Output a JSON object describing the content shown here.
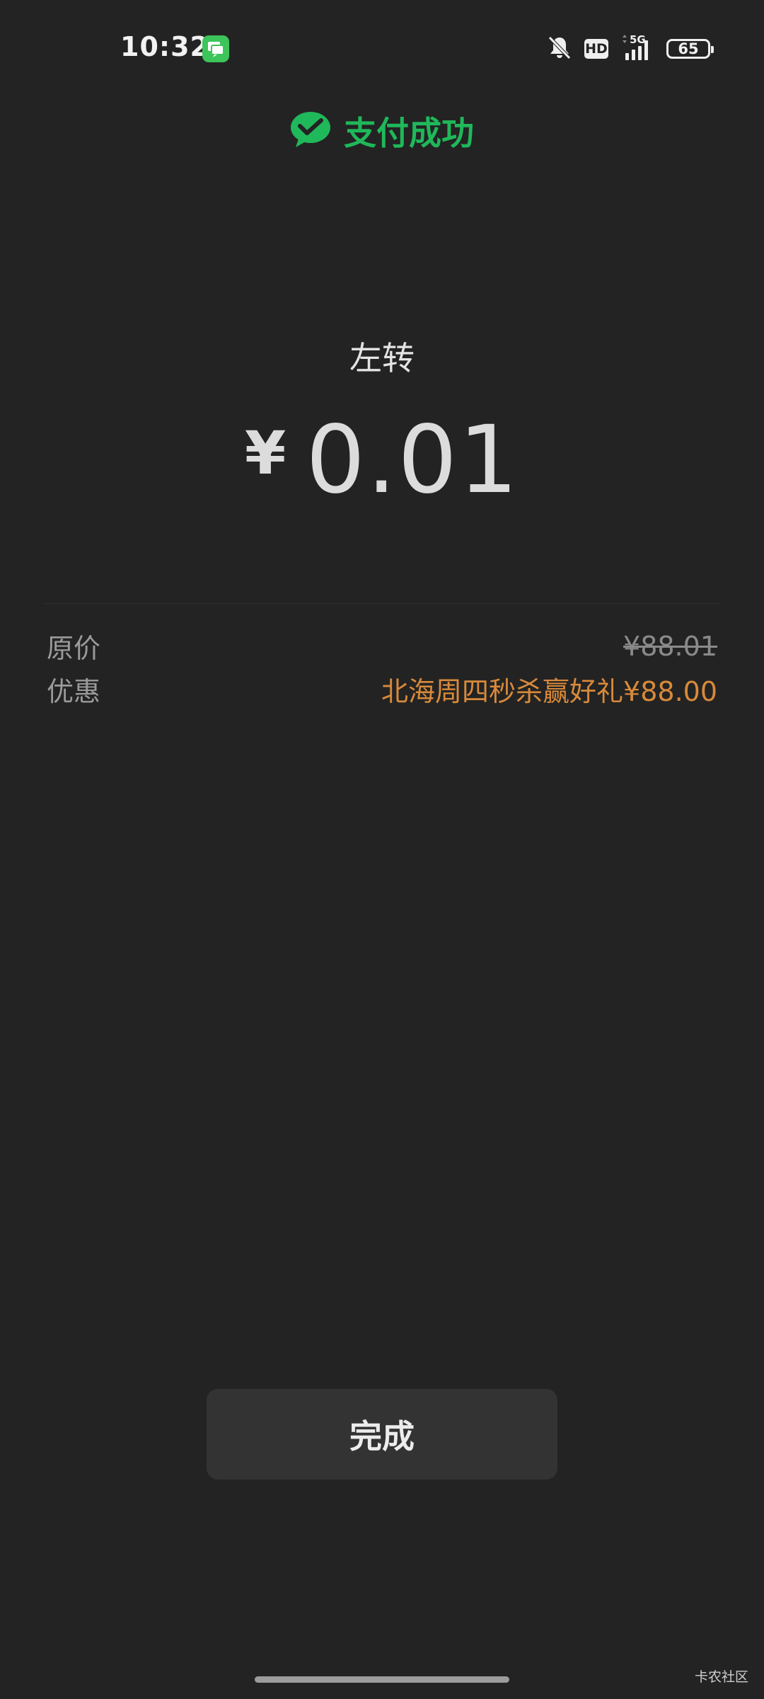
{
  "status_bar": {
    "time": "10:32",
    "hd": "HD",
    "network": "5G",
    "battery": "65"
  },
  "header": {
    "title": "支付成功"
  },
  "payment": {
    "merchant": "左转",
    "currency": "¥",
    "amount": "0.01"
  },
  "details": {
    "original_label": "原价",
    "original_value": "¥88.01",
    "discount_label": "优惠",
    "discount_value": "北海周四秒杀赢好礼¥88.00"
  },
  "actions": {
    "done_label": "完成"
  },
  "watermark": "卡农社区",
  "colors": {
    "background": "#232323",
    "success_green": "#1fb85a",
    "discount_orange": "#d88a3a",
    "button_bg": "#333333"
  }
}
